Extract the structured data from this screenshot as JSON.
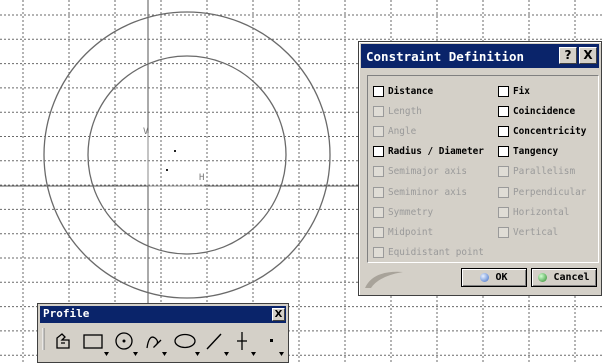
{
  "sketch": {
    "h_axis_label": "H",
    "v_axis_label": "V"
  },
  "dialog": {
    "title": "Constraint Definition",
    "help_label": "?",
    "close_label": "X",
    "left_options": [
      {
        "label": "Distance",
        "enabled": true
      },
      {
        "label": "Length",
        "enabled": false
      },
      {
        "label": "Angle",
        "enabled": false
      },
      {
        "label": "Radius / Diameter",
        "enabled": true
      },
      {
        "label": "Semimajor axis",
        "enabled": false
      },
      {
        "label": "Semiminor axis",
        "enabled": false
      },
      {
        "label": "Symmetry",
        "enabled": false
      },
      {
        "label": "Midpoint",
        "enabled": false
      },
      {
        "label": "Equidistant point",
        "enabled": false
      }
    ],
    "right_options": [
      {
        "label": "Fix",
        "enabled": true
      },
      {
        "label": "Coincidence",
        "enabled": true
      },
      {
        "label": "Concentricity",
        "enabled": true
      },
      {
        "label": "Tangency",
        "enabled": true
      },
      {
        "label": "Parallelism",
        "enabled": false
      },
      {
        "label": "Perpendicular",
        "enabled": false
      },
      {
        "label": "Horizontal",
        "enabled": false
      },
      {
        "label": "Vertical",
        "enabled": false
      }
    ],
    "ok_label": "OK",
    "cancel_label": "Cancel"
  },
  "toolbar": {
    "title": "Profile",
    "close_label": "X",
    "tools": [
      "profile-icon",
      "rectangle-icon",
      "circle-icon",
      "spline-icon",
      "ellipse-icon",
      "line-icon",
      "axis-icon",
      "point-icon"
    ]
  }
}
